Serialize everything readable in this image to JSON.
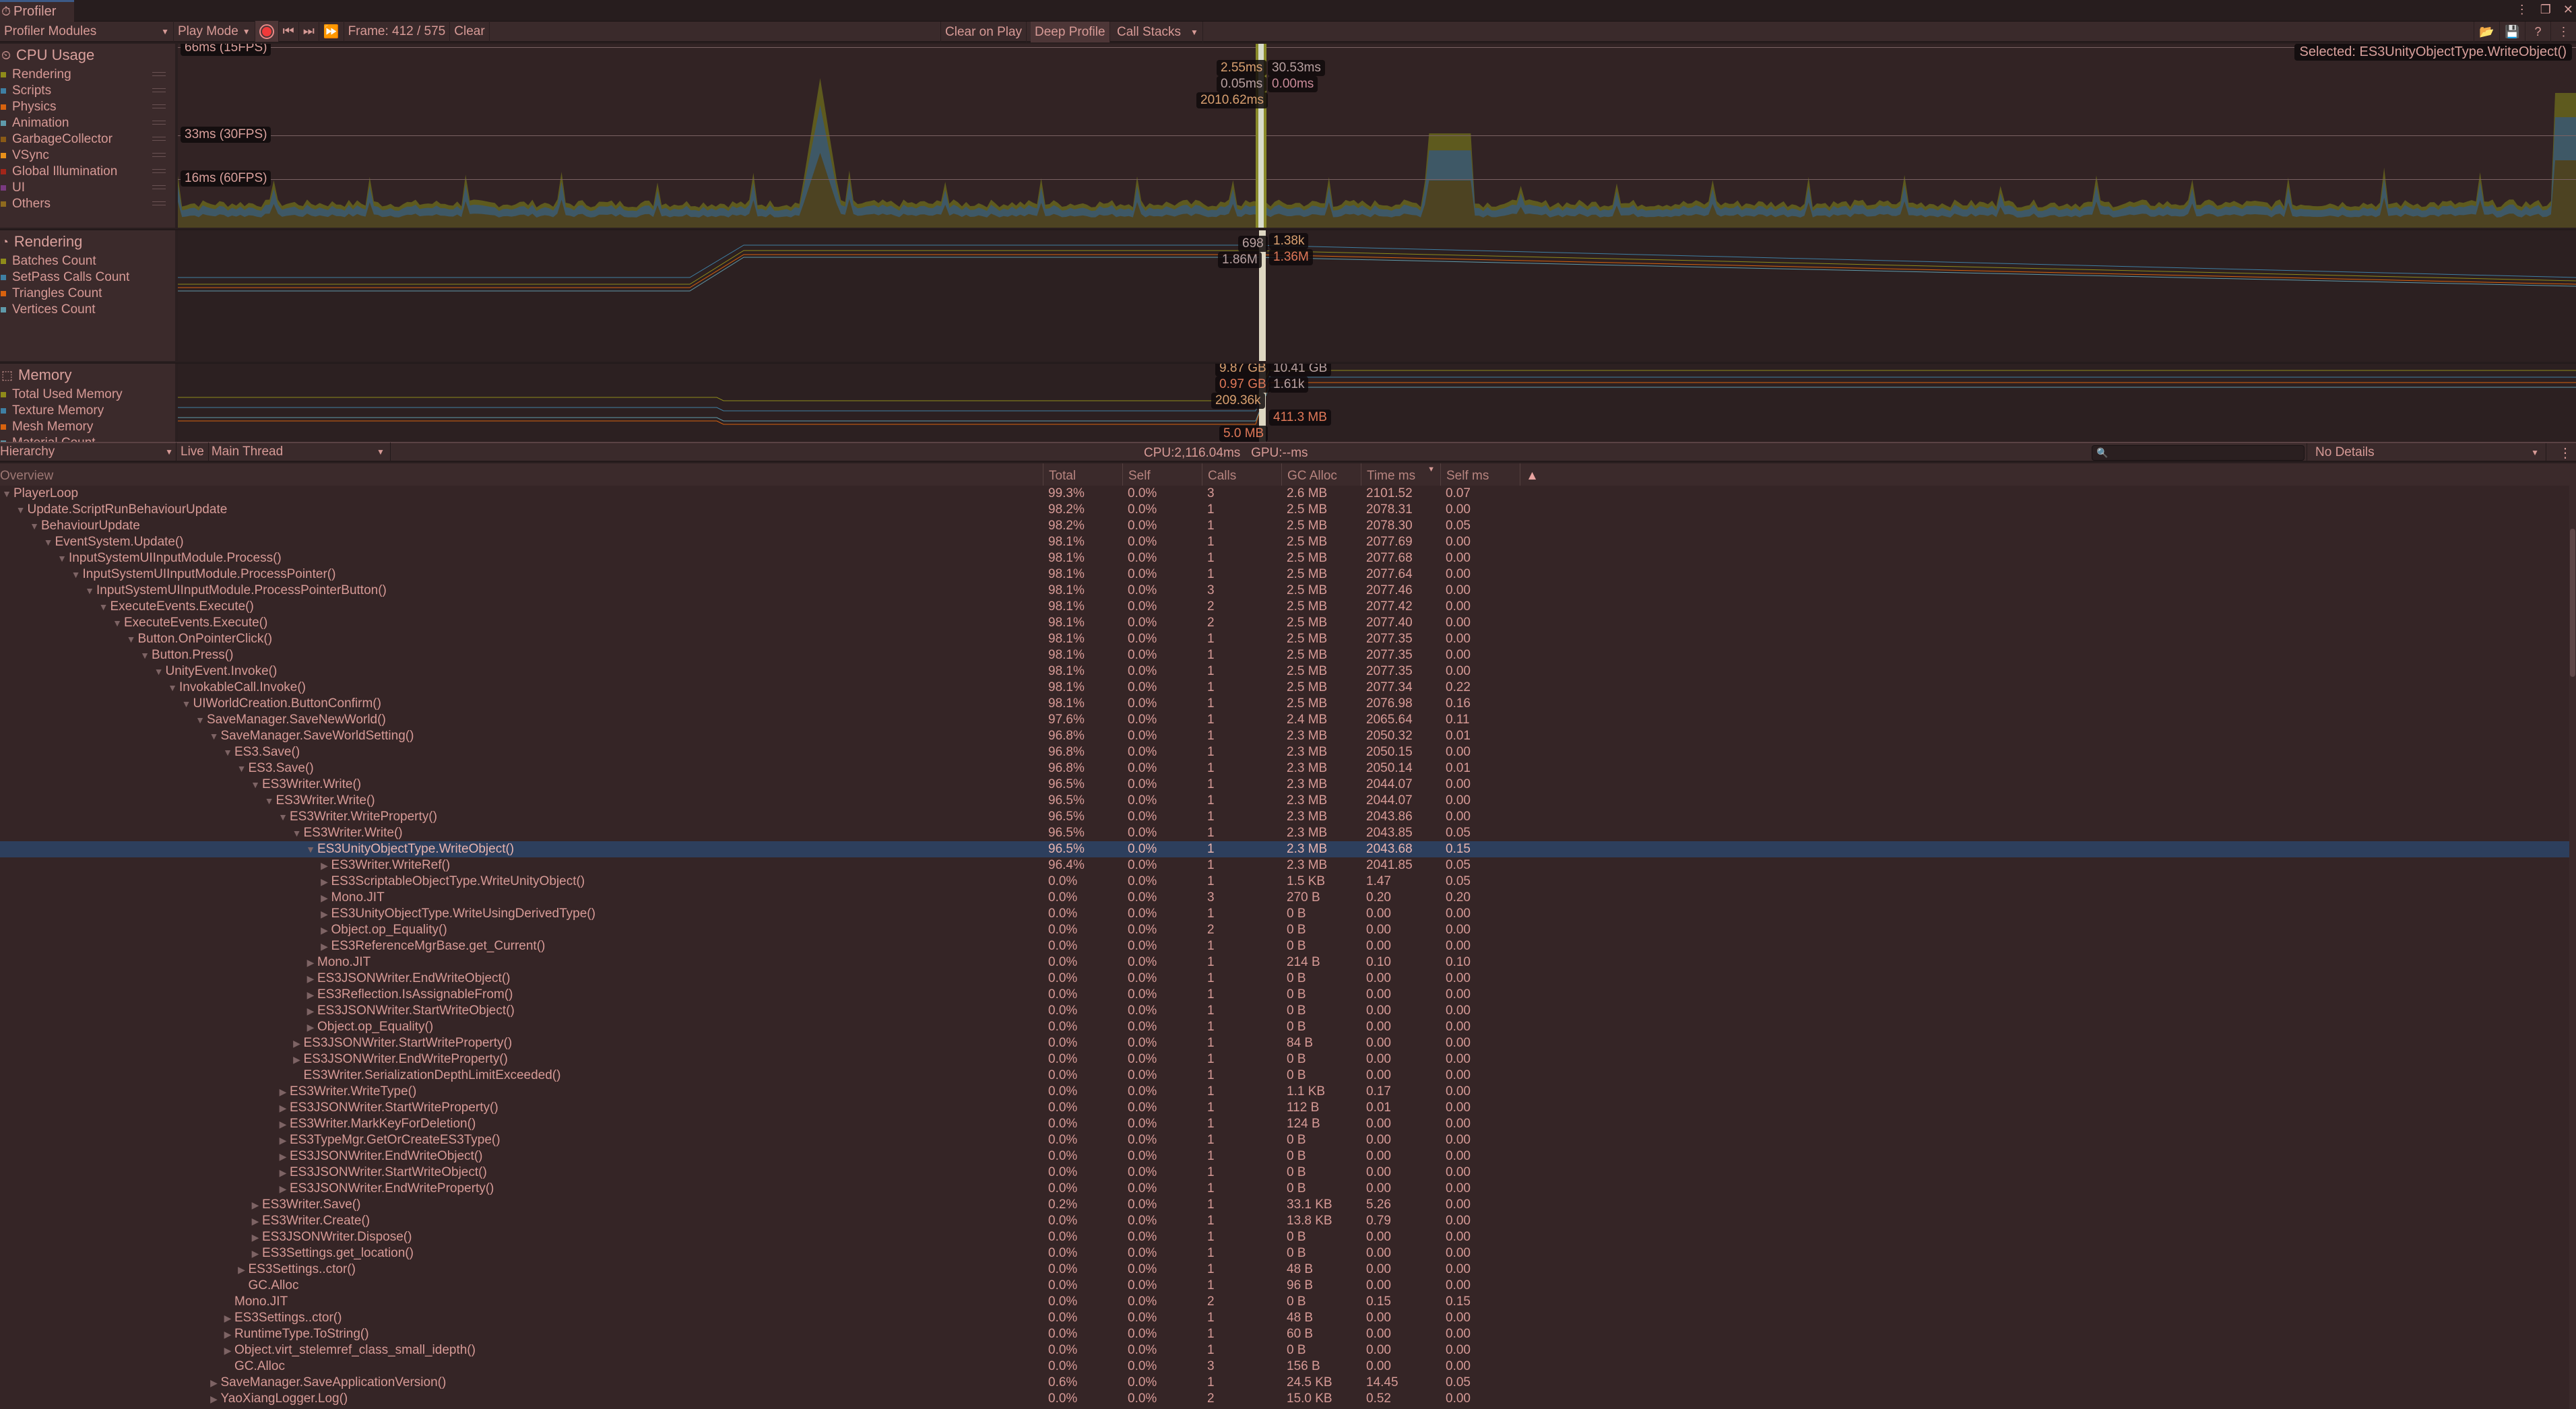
{
  "window": {
    "title": "Profiler",
    "controls": [
      "more-options-icon",
      "maximize-icon",
      "close-icon"
    ]
  },
  "toolbar": {
    "modules_dropdown": "Profiler Modules",
    "play_mode": "Play Mode",
    "frame_label": "Frame: 412 / 575",
    "clear": "Clear",
    "clear_on_play": "Clear on Play",
    "deep_profile": "Deep Profile",
    "call_stacks": "Call Stacks",
    "right_icons": [
      "load-icon",
      "save-icon",
      "help-icon",
      "more-icon"
    ]
  },
  "cpu_module": {
    "title": "CPU Usage",
    "legend": [
      {
        "label": "Rendering",
        "color": "#8f8b1a"
      },
      {
        "label": "Scripts",
        "color": "#3f7fa3"
      },
      {
        "label": "Physics",
        "color": "#d8620e"
      },
      {
        "label": "Animation",
        "color": "#5f9aaa"
      },
      {
        "label": "GarbageCollector",
        "color": "#8a5a16"
      },
      {
        "label": "VSync",
        "color": "#e8901a"
      },
      {
        "label": "Global Illumination",
        "color": "#a3261a"
      },
      {
        "label": "UI",
        "color": "#7a3a80"
      },
      {
        "label": "Others",
        "color": "#8e6a1e"
      }
    ],
    "gridlines": [
      "66ms (15FPS)",
      "33ms (30FPS)",
      "16ms (60FPS)"
    ],
    "values_left": [
      "2.55ms",
      "0.05ms",
      "2010.62ms"
    ],
    "values_right": [
      "30.53ms",
      "0.00ms"
    ],
    "selected_tip": "Selected: ES3UnityObjectType.WriteObject()"
  },
  "rendering_module": {
    "title": "Rendering",
    "legend": [
      {
        "label": "Batches Count",
        "color": "#8f8b1a"
      },
      {
        "label": "SetPass Calls Count",
        "color": "#3f7fa3"
      },
      {
        "label": "Triangles Count",
        "color": "#d8620e"
      },
      {
        "label": "Vertices Count",
        "color": "#5f9aaa"
      }
    ],
    "values_left": [
      "698",
      "1.86M"
    ],
    "values_right": [
      "1.38k",
      "1.36M"
    ]
  },
  "memory_module": {
    "title": "Memory",
    "legend": [
      {
        "label": "Total Used Memory",
        "color": "#8f8b1a"
      },
      {
        "label": "Texture Memory",
        "color": "#3f7fa3"
      },
      {
        "label": "Mesh Memory",
        "color": "#d8620e"
      },
      {
        "label": "Material Count",
        "color": "#5f9aaa"
      }
    ],
    "values_left": [
      "9.87 GB",
      "0.97 GB",
      "209.36k",
      "5.0 MB"
    ],
    "values_right": [
      "10.41 GB",
      "1.61k",
      "411.3 MB"
    ]
  },
  "hierarchy_toolbar": {
    "view": "Hierarchy",
    "live": "Live",
    "thread": "Main Thread",
    "cpu_gpu": "CPU:2,116.04ms   GPU:--ms",
    "search_placeholder": "",
    "details": "No Details"
  },
  "table": {
    "columns": [
      "Overview",
      "Total",
      "Self",
      "Calls",
      "GC Alloc",
      "Time ms",
      "Self ms"
    ],
    "sorted_column": "Time ms",
    "rows": [
      {
        "name": "PlayerLoop",
        "depth": 0,
        "toggle": "open",
        "total": "99.3%",
        "self": "0.0%",
        "calls": "3",
        "gc": "2.6 MB",
        "time": "2101.52",
        "selfms": "0.07"
      },
      {
        "name": "Update.ScriptRunBehaviourUpdate",
        "depth": 1,
        "toggle": "open",
        "total": "98.2%",
        "self": "0.0%",
        "calls": "1",
        "gc": "2.5 MB",
        "time": "2078.31",
        "selfms": "0.00"
      },
      {
        "name": "BehaviourUpdate",
        "depth": 2,
        "toggle": "open",
        "total": "98.2%",
        "self": "0.0%",
        "calls": "1",
        "gc": "2.5 MB",
        "time": "2078.30",
        "selfms": "0.05"
      },
      {
        "name": "EventSystem.Update()",
        "depth": 3,
        "toggle": "open",
        "total": "98.1%",
        "self": "0.0%",
        "calls": "1",
        "gc": "2.5 MB",
        "time": "2077.69",
        "selfms": "0.00"
      },
      {
        "name": "InputSystemUIInputModule.Process()",
        "depth": 4,
        "toggle": "open",
        "total": "98.1%",
        "self": "0.0%",
        "calls": "1",
        "gc": "2.5 MB",
        "time": "2077.68",
        "selfms": "0.00"
      },
      {
        "name": "InputSystemUIInputModule.ProcessPointer()",
        "depth": 5,
        "toggle": "open",
        "total": "98.1%",
        "self": "0.0%",
        "calls": "1",
        "gc": "2.5 MB",
        "time": "2077.64",
        "selfms": "0.00"
      },
      {
        "name": "InputSystemUIInputModule.ProcessPointerButton()",
        "depth": 6,
        "toggle": "open",
        "total": "98.1%",
        "self": "0.0%",
        "calls": "3",
        "gc": "2.5 MB",
        "time": "2077.46",
        "selfms": "0.00"
      },
      {
        "name": "ExecuteEvents.Execute()",
        "depth": 7,
        "toggle": "open",
        "total": "98.1%",
        "self": "0.0%",
        "calls": "2",
        "gc": "2.5 MB",
        "time": "2077.42",
        "selfms": "0.00"
      },
      {
        "name": "ExecuteEvents.Execute()",
        "depth": 8,
        "toggle": "open",
        "total": "98.1%",
        "self": "0.0%",
        "calls": "2",
        "gc": "2.5 MB",
        "time": "2077.40",
        "selfms": "0.00"
      },
      {
        "name": "Button.OnPointerClick()",
        "depth": 9,
        "toggle": "open",
        "total": "98.1%",
        "self": "0.0%",
        "calls": "1",
        "gc": "2.5 MB",
        "time": "2077.35",
        "selfms": "0.00"
      },
      {
        "name": "Button.Press()",
        "depth": 10,
        "toggle": "open",
        "total": "98.1%",
        "self": "0.0%",
        "calls": "1",
        "gc": "2.5 MB",
        "time": "2077.35",
        "selfms": "0.00"
      },
      {
        "name": "UnityEvent.Invoke()",
        "depth": 11,
        "toggle": "open",
        "total": "98.1%",
        "self": "0.0%",
        "calls": "1",
        "gc": "2.5 MB",
        "time": "2077.35",
        "selfms": "0.00"
      },
      {
        "name": "InvokableCall.Invoke()",
        "depth": 12,
        "toggle": "open",
        "total": "98.1%",
        "self": "0.0%",
        "calls": "1",
        "gc": "2.5 MB",
        "time": "2077.34",
        "selfms": "0.22"
      },
      {
        "name": "UIWorldCreation.ButtonConfirm()",
        "depth": 13,
        "toggle": "open",
        "total": "98.1%",
        "self": "0.0%",
        "calls": "1",
        "gc": "2.5 MB",
        "time": "2076.98",
        "selfms": "0.16"
      },
      {
        "name": "SaveManager.SaveNewWorld()",
        "depth": 14,
        "toggle": "open",
        "total": "97.6%",
        "self": "0.0%",
        "calls": "1",
        "gc": "2.4 MB",
        "time": "2065.64",
        "selfms": "0.11"
      },
      {
        "name": "SaveManager.SaveWorldSetting()",
        "depth": 15,
        "toggle": "open",
        "total": "96.8%",
        "self": "0.0%",
        "calls": "1",
        "gc": "2.3 MB",
        "time": "2050.32",
        "selfms": "0.01"
      },
      {
        "name": "ES3.Save()",
        "depth": 16,
        "toggle": "open",
        "total": "96.8%",
        "self": "0.0%",
        "calls": "1",
        "gc": "2.3 MB",
        "time": "2050.15",
        "selfms": "0.00"
      },
      {
        "name": "ES3.Save()",
        "depth": 17,
        "toggle": "open",
        "total": "96.8%",
        "self": "0.0%",
        "calls": "1",
        "gc": "2.3 MB",
        "time": "2050.14",
        "selfms": "0.01"
      },
      {
        "name": "ES3Writer.Write()",
        "depth": 18,
        "toggle": "open",
        "total": "96.5%",
        "self": "0.0%",
        "calls": "1",
        "gc": "2.3 MB",
        "time": "2044.07",
        "selfms": "0.00"
      },
      {
        "name": "ES3Writer.Write()",
        "depth": 19,
        "toggle": "open",
        "total": "96.5%",
        "self": "0.0%",
        "calls": "1",
        "gc": "2.3 MB",
        "time": "2044.07",
        "selfms": "0.00"
      },
      {
        "name": "ES3Writer.WriteProperty()",
        "depth": 20,
        "toggle": "open",
        "total": "96.5%",
        "self": "0.0%",
        "calls": "1",
        "gc": "2.3 MB",
        "time": "2043.86",
        "selfms": "0.00"
      },
      {
        "name": "ES3Writer.Write()",
        "depth": 21,
        "toggle": "open",
        "total": "96.5%",
        "self": "0.0%",
        "calls": "1",
        "gc": "2.3 MB",
        "time": "2043.85",
        "selfms": "0.05"
      },
      {
        "name": "ES3UnityObjectType.WriteObject()",
        "depth": 22,
        "toggle": "open",
        "selected": true,
        "total": "96.5%",
        "self": "0.0%",
        "calls": "1",
        "gc": "2.3 MB",
        "time": "2043.68",
        "selfms": "0.15"
      },
      {
        "name": "ES3Writer.WriteRef()",
        "depth": 23,
        "toggle": "closed",
        "total": "96.4%",
        "self": "0.0%",
        "calls": "1",
        "gc": "2.3 MB",
        "time": "2041.85",
        "selfms": "0.05"
      },
      {
        "name": "ES3ScriptableObjectType.WriteUnityObject()",
        "depth": 23,
        "toggle": "closed",
        "total": "0.0%",
        "self": "0.0%",
        "calls": "1",
        "gc": "1.5 KB",
        "time": "1.47",
        "selfms": "0.05"
      },
      {
        "name": "Mono.JIT",
        "depth": 23,
        "toggle": "closed",
        "total": "0.0%",
        "self": "0.0%",
        "calls": "3",
        "gc": "270 B",
        "time": "0.20",
        "selfms": "0.20"
      },
      {
        "name": "ES3UnityObjectType.WriteUsingDerivedType()",
        "depth": 23,
        "toggle": "closed",
        "total": "0.0%",
        "self": "0.0%",
        "calls": "1",
        "gc": "0 B",
        "time": "0.00",
        "selfms": "0.00"
      },
      {
        "name": "Object.op_Equality()",
        "depth": 23,
        "toggle": "closed",
        "total": "0.0%",
        "self": "0.0%",
        "calls": "2",
        "gc": "0 B",
        "time": "0.00",
        "selfms": "0.00"
      },
      {
        "name": "ES3ReferenceMgrBase.get_Current()",
        "depth": 23,
        "toggle": "closed",
        "total": "0.0%",
        "self": "0.0%",
        "calls": "1",
        "gc": "0 B",
        "time": "0.00",
        "selfms": "0.00"
      },
      {
        "name": "Mono.JIT",
        "depth": 22,
        "toggle": "closed",
        "total": "0.0%",
        "self": "0.0%",
        "calls": "1",
        "gc": "214 B",
        "time": "0.10",
        "selfms": "0.10"
      },
      {
        "name": "ES3JSONWriter.EndWriteObject()",
        "depth": 22,
        "toggle": "closed",
        "total": "0.0%",
        "self": "0.0%",
        "calls": "1",
        "gc": "0 B",
        "time": "0.00",
        "selfms": "0.00"
      },
      {
        "name": "ES3Reflection.IsAssignableFrom()",
        "depth": 22,
        "toggle": "closed",
        "total": "0.0%",
        "self": "0.0%",
        "calls": "1",
        "gc": "0 B",
        "time": "0.00",
        "selfms": "0.00"
      },
      {
        "name": "ES3JSONWriter.StartWriteObject()",
        "depth": 22,
        "toggle": "closed",
        "total": "0.0%",
        "self": "0.0%",
        "calls": "1",
        "gc": "0 B",
        "time": "0.00",
        "selfms": "0.00"
      },
      {
        "name": "Object.op_Equality()",
        "depth": 22,
        "toggle": "closed",
        "total": "0.0%",
        "self": "0.0%",
        "calls": "1",
        "gc": "0 B",
        "time": "0.00",
        "selfms": "0.00"
      },
      {
        "name": "ES3JSONWriter.StartWriteProperty()",
        "depth": 21,
        "toggle": "closed",
        "total": "0.0%",
        "self": "0.0%",
        "calls": "1",
        "gc": "84 B",
        "time": "0.00",
        "selfms": "0.00"
      },
      {
        "name": "ES3JSONWriter.EndWriteProperty()",
        "depth": 21,
        "toggle": "closed",
        "total": "0.0%",
        "self": "0.0%",
        "calls": "1",
        "gc": "0 B",
        "time": "0.00",
        "selfms": "0.00"
      },
      {
        "name": "ES3Writer.SerializationDepthLimitExceeded()",
        "depth": 21,
        "toggle": "none",
        "total": "0.0%",
        "self": "0.0%",
        "calls": "1",
        "gc": "0 B",
        "time": "0.00",
        "selfms": "0.00"
      },
      {
        "name": "ES3Writer.WriteType()",
        "depth": 20,
        "toggle": "closed",
        "total": "0.0%",
        "self": "0.0%",
        "calls": "1",
        "gc": "1.1 KB",
        "time": "0.17",
        "selfms": "0.00"
      },
      {
        "name": "ES3JSONWriter.StartWriteProperty()",
        "depth": 20,
        "toggle": "closed",
        "total": "0.0%",
        "self": "0.0%",
        "calls": "1",
        "gc": "112 B",
        "time": "0.01",
        "selfms": "0.00"
      },
      {
        "name": "ES3Writer.MarkKeyForDeletion()",
        "depth": 20,
        "toggle": "closed",
        "total": "0.0%",
        "self": "0.0%",
        "calls": "1",
        "gc": "124 B",
        "time": "0.00",
        "selfms": "0.00"
      },
      {
        "name": "ES3TypeMgr.GetOrCreateES3Type()",
        "depth": 20,
        "toggle": "closed",
        "total": "0.0%",
        "self": "0.0%",
        "calls": "1",
        "gc": "0 B",
        "time": "0.00",
        "selfms": "0.00"
      },
      {
        "name": "ES3JSONWriter.EndWriteObject()",
        "depth": 20,
        "toggle": "closed",
        "total": "0.0%",
        "self": "0.0%",
        "calls": "1",
        "gc": "0 B",
        "time": "0.00",
        "selfms": "0.00"
      },
      {
        "name": "ES3JSONWriter.StartWriteObject()",
        "depth": 20,
        "toggle": "closed",
        "total": "0.0%",
        "self": "0.0%",
        "calls": "1",
        "gc": "0 B",
        "time": "0.00",
        "selfms": "0.00"
      },
      {
        "name": "ES3JSONWriter.EndWriteProperty()",
        "depth": 20,
        "toggle": "closed",
        "total": "0.0%",
        "self": "0.0%",
        "calls": "1",
        "gc": "0 B",
        "time": "0.00",
        "selfms": "0.00"
      },
      {
        "name": "ES3Writer.Save()",
        "depth": 18,
        "toggle": "closed",
        "total": "0.2%",
        "self": "0.0%",
        "calls": "1",
        "gc": "33.1 KB",
        "time": "5.26",
        "selfms": "0.00"
      },
      {
        "name": "ES3Writer.Create()",
        "depth": 18,
        "toggle": "closed",
        "total": "0.0%",
        "self": "0.0%",
        "calls": "1",
        "gc": "13.8 KB",
        "time": "0.79",
        "selfms": "0.00"
      },
      {
        "name": "ES3JSONWriter.Dispose()",
        "depth": 18,
        "toggle": "closed",
        "total": "0.0%",
        "self": "0.0%",
        "calls": "1",
        "gc": "0 B",
        "time": "0.00",
        "selfms": "0.00"
      },
      {
        "name": "ES3Settings.get_location()",
        "depth": 18,
        "toggle": "closed",
        "total": "0.0%",
        "self": "0.0%",
        "calls": "1",
        "gc": "0 B",
        "time": "0.00",
        "selfms": "0.00"
      },
      {
        "name": "ES3Settings..ctor()",
        "depth": 17,
        "toggle": "closed",
        "total": "0.0%",
        "self": "0.0%",
        "calls": "1",
        "gc": "48 B",
        "time": "0.00",
        "selfms": "0.00"
      },
      {
        "name": "GC.Alloc",
        "depth": 17,
        "toggle": "none",
        "total": "0.0%",
        "self": "0.0%",
        "calls": "1",
        "gc": "96 B",
        "time": "0.00",
        "selfms": "0.00"
      },
      {
        "name": "Mono.JIT",
        "depth": 16,
        "toggle": "none",
        "total": "0.0%",
        "self": "0.0%",
        "calls": "2",
        "gc": "0 B",
        "time": "0.15",
        "selfms": "0.15"
      },
      {
        "name": "ES3Settings..ctor()",
        "depth": 16,
        "toggle": "closed",
        "total": "0.0%",
        "self": "0.0%",
        "calls": "1",
        "gc": "48 B",
        "time": "0.00",
        "selfms": "0.00"
      },
      {
        "name": "RuntimeType.ToString()",
        "depth": 16,
        "toggle": "closed",
        "total": "0.0%",
        "self": "0.0%",
        "calls": "1",
        "gc": "60 B",
        "time": "0.00",
        "selfms": "0.00"
      },
      {
        "name": "Object.virt_stelemref_class_small_idepth()",
        "depth": 16,
        "toggle": "closed",
        "total": "0.0%",
        "self": "0.0%",
        "calls": "1",
        "gc": "0 B",
        "time": "0.00",
        "selfms": "0.00"
      },
      {
        "name": "GC.Alloc",
        "depth": 16,
        "toggle": "none",
        "total": "0.0%",
        "self": "0.0%",
        "calls": "3",
        "gc": "156 B",
        "time": "0.00",
        "selfms": "0.00"
      },
      {
        "name": "SaveManager.SaveApplicationVersion()",
        "depth": 15,
        "toggle": "closed",
        "total": "0.6%",
        "self": "0.0%",
        "calls": "1",
        "gc": "24.5 KB",
        "time": "14.45",
        "selfms": "0.05"
      },
      {
        "name": "YaoXiangLogger.Log()",
        "depth": 15,
        "toggle": "closed",
        "total": "0.0%",
        "self": "0.0%",
        "calls": "2",
        "gc": "15.0 KB",
        "time": "0.52",
        "selfms": "0.00"
      }
    ]
  }
}
